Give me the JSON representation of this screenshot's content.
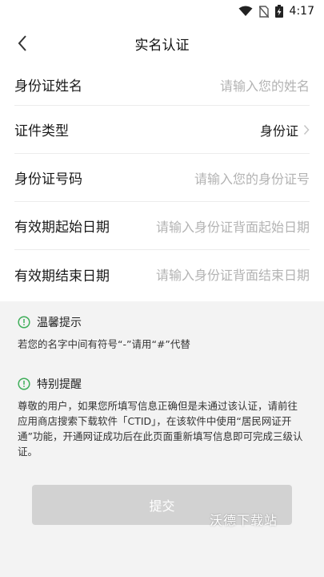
{
  "status_bar": {
    "time": "4:17",
    "icons": [
      "wifi-icon",
      "no-sim-icon",
      "battery-charging-icon"
    ]
  },
  "nav": {
    "title": "实名认证",
    "back_icon": "chevron-left-icon"
  },
  "form": {
    "name": {
      "label": "身份证姓名",
      "placeholder": "请输入您的姓名"
    },
    "type": {
      "label": "证件类型",
      "value": "身份证"
    },
    "idno": {
      "label": "身份证号码",
      "placeholder": "请输入您的身份证号"
    },
    "start": {
      "label": "有效期起始日期",
      "placeholder": "请输入身份证背面起始日期"
    },
    "end": {
      "label": "有效期结束日期",
      "placeholder": "请输入身份证背面结束日期"
    }
  },
  "tips": {
    "warm": {
      "title": "温馨提示",
      "text": "若您的名字中间有符号“-”请用“#”代替"
    },
    "special": {
      "title": "特别提醒",
      "text": "尊敬的用户，如果您所填写信息正确但是未通过该认证，请前往应用商店搜索下载软件「CTID」，在该软件中使用“居民网证开通”功能，开通网证成功后在此页面重新填写信息即可完成三级认证。"
    }
  },
  "submit_label": "提交",
  "watermark": "沃德下载站",
  "colors": {
    "accent_green": "#3fae5a",
    "placeholder": "#b3b3b3",
    "button_disabled": "#d2d2d2"
  }
}
